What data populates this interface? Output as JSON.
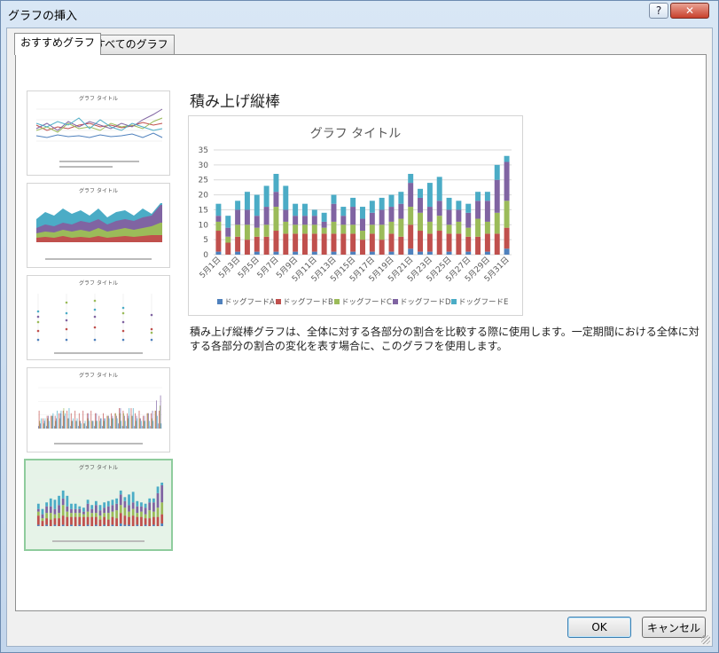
{
  "window": {
    "title": "グラフの挿入",
    "help_icon": "?",
    "close_icon": "✕"
  },
  "tabs": [
    {
      "label": "おすすめグラフ",
      "active": true
    },
    {
      "label": "すべてのグラフ",
      "active": false
    }
  ],
  "thumbnails": [
    {
      "kind": "line",
      "title": "グラフ タイトル",
      "selected": false
    },
    {
      "kind": "area",
      "title": "グラフ タイトル",
      "selected": false
    },
    {
      "kind": "scatter",
      "title": "グラフ タイトル",
      "selected": false
    },
    {
      "kind": "clustered-column",
      "title": "グラフ タイトル",
      "selected": false
    },
    {
      "kind": "stacked-column",
      "title": "グラフ タイトル",
      "selected": true
    }
  ],
  "preview": {
    "heading": "積み上げ縦棒",
    "description": "積み上げ縦棒グラフは、全体に対する各部分の割合を比較する際に使用します。一定期間における全体に対する各部分の割合の変化を表す場合に、このグラフを使用します。"
  },
  "buttons": {
    "ok": "OK",
    "cancel": "キャンセル"
  },
  "chart_data": {
    "type": "bar",
    "stacked": true,
    "title": "グラフ タイトル",
    "xlabel": "",
    "ylabel": "",
    "ylim": [
      0,
      35
    ],
    "y_ticks": [
      0,
      5,
      10,
      15,
      20,
      25,
      30,
      35
    ],
    "grid": true,
    "legend": "bottom",
    "categories": [
      "5月1日",
      "5月2日",
      "5月3日",
      "5月4日",
      "5月5日",
      "5月6日",
      "5月7日",
      "5月8日",
      "5月9日",
      "5月10日",
      "5月11日",
      "5月12日",
      "5月13日",
      "5月14日",
      "5月15日",
      "5月16日",
      "5月17日",
      "5月18日",
      "5月19日",
      "5月20日",
      "5月21日",
      "5月22日",
      "5月23日",
      "5月24日",
      "5月25日",
      "5月26日",
      "5月27日",
      "5月28日",
      "5月29日",
      "5月30日",
      "5月31日"
    ],
    "x_tick_labels": [
      "5月1日",
      "5月3日",
      "5月5日",
      "5月7日",
      "5月9日",
      "5月11日",
      "5月13日",
      "5月15日",
      "5月17日",
      "5月19日",
      "5月21日",
      "5月23日",
      "5月25日",
      "5月27日",
      "5月29日",
      "5月31日"
    ],
    "series": [
      {
        "name": "ドッグフードA",
        "color": "#4f81bd",
        "values": [
          1,
          0,
          1,
          0,
          1,
          0,
          1,
          0,
          1,
          0,
          1,
          0,
          1,
          0,
          1,
          0,
          1,
          0,
          1,
          0,
          2,
          1,
          1,
          0,
          1,
          0,
          1,
          0,
          1,
          0,
          2
        ]
      },
      {
        "name": "ドッグフードB",
        "color": "#c0504d",
        "values": [
          7,
          4,
          5,
          5,
          5,
          6,
          7,
          7,
          6,
          7,
          6,
          7,
          6,
          7,
          6,
          5,
          6,
          5,
          6,
          6,
          8,
          7,
          6,
          8,
          6,
          7,
          5,
          6,
          6,
          7,
          7
        ]
      },
      {
        "name": "ドッグフードC",
        "color": "#9bbb59",
        "values": [
          3,
          2,
          4,
          5,
          3,
          4,
          8,
          4,
          3,
          3,
          3,
          2,
          4,
          3,
          3,
          3,
          3,
          5,
          4,
          6,
          6,
          6,
          4,
          5,
          3,
          4,
          3,
          6,
          4,
          7,
          9
        ]
      },
      {
        "name": "ドッグフードD",
        "color": "#8064a2",
        "values": [
          2,
          3,
          5,
          5,
          4,
          6,
          5,
          4,
          3,
          3,
          3,
          2,
          6,
          3,
          6,
          4,
          4,
          5,
          5,
          5,
          8,
          5,
          5,
          5,
          5,
          4,
          5,
          6,
          7,
          11,
          13
        ]
      },
      {
        "name": "ドッグフードE",
        "color": "#4bacc6",
        "values": [
          4,
          4,
          3,
          6,
          7,
          7,
          6,
          8,
          4,
          4,
          2,
          3,
          3,
          3,
          3,
          4,
          4,
          4,
          4,
          4,
          3,
          3,
          8,
          8,
          4,
          3,
          3,
          3,
          3,
          5,
          2
        ]
      }
    ]
  }
}
